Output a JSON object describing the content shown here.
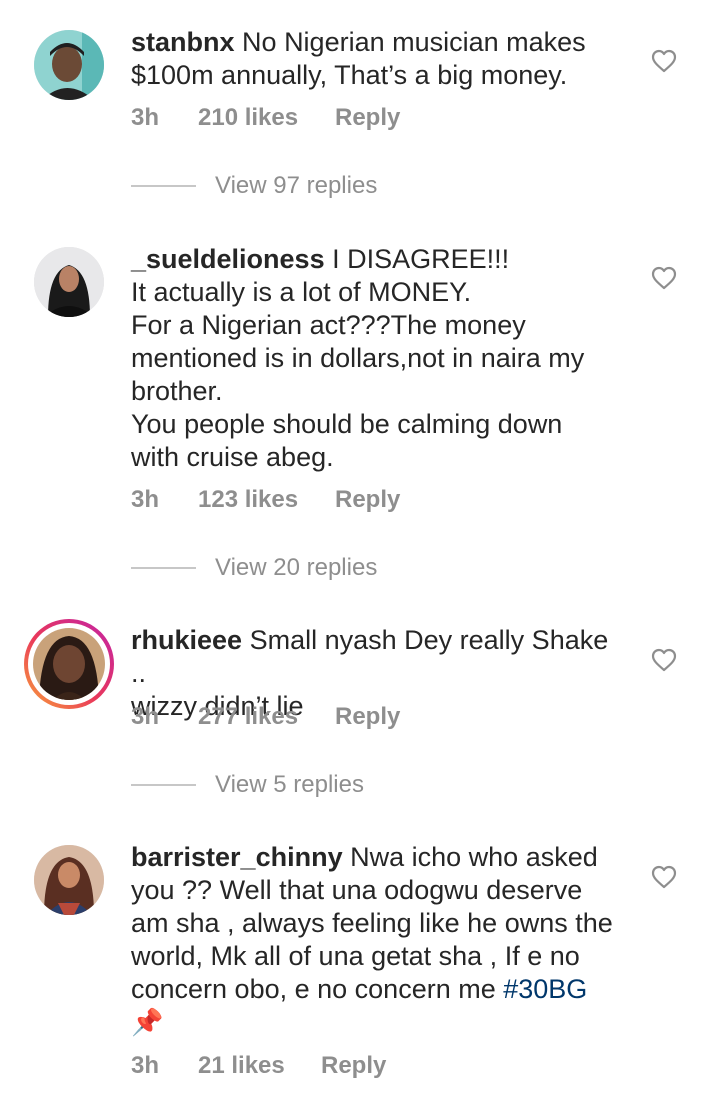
{
  "comments": [
    {
      "username": "stanbnx",
      "text": "No Nigerian musician makes\n$100m annually, That’s a big money.",
      "time": "3h",
      "likes": "210 likes",
      "reply": "Reply",
      "view_replies": "View 97 replies"
    },
    {
      "username": "_sueldelioness",
      "text": "I DISAGREE!!!\nIt actually is a lot of MONEY.\nFor a Nigerian act???The money\nmentioned is in dollars,not in naira my\nbrother.\nYou people should be calming down\nwith cruise abeg.",
      "time": "3h",
      "likes": "123 likes",
      "reply": "Reply",
      "view_replies": "View 20 replies"
    },
    {
      "username": "rhukieee",
      "text": "Small nyash Dey really Shake ..\nwizzy didn’t lie",
      "time": "3h",
      "likes": "277 likes",
      "reply": "Reply",
      "view_replies": "View 5 replies"
    },
    {
      "username": "barrister_chinny",
      "text": "Nwa icho who asked\nyou ?? Well that una odogwu deserve\nam sha , always feeling like he owns the\nworld, Mk all of una getat sha , If e no\nconcern obo, e no concern me ",
      "hashtag": "#30BG",
      "emoji": "📌",
      "time": "3h",
      "likes": "21 likes",
      "reply": "Reply"
    }
  ],
  "icons": {
    "like": "heart-outline-icon",
    "pin": "pushpin-emoji"
  },
  "colors": {
    "text": "#262626",
    "secondary": "#8e8e8e",
    "hashtag": "#00376b",
    "divider": "#c7c7c7"
  }
}
